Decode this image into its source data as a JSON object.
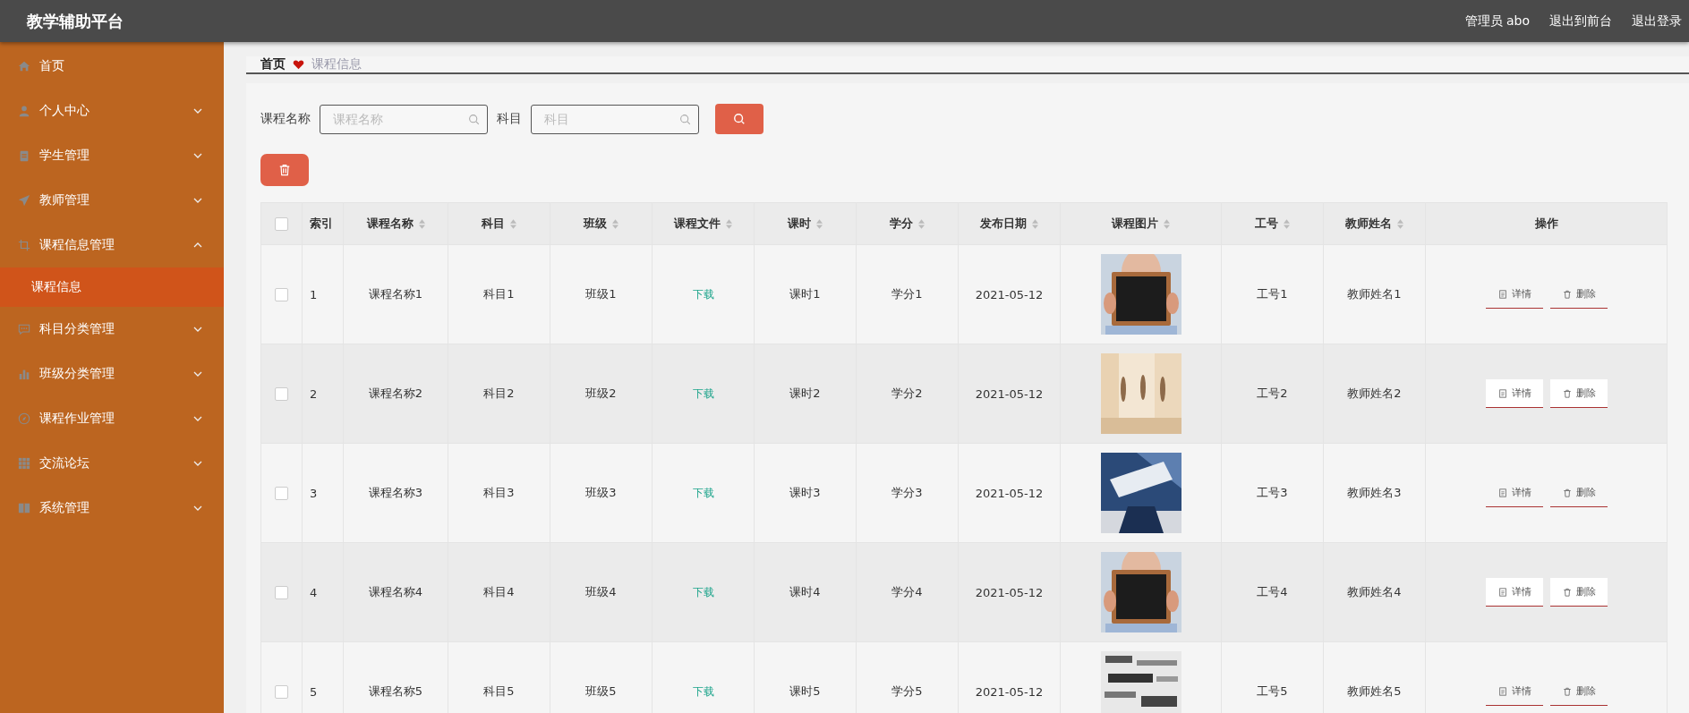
{
  "header": {
    "title": "教学辅助平台",
    "links": [
      "管理员 abo",
      "退出到前台",
      "退出登录"
    ]
  },
  "sidebar": {
    "items": [
      {
        "label": "首页",
        "selected": false
      },
      {
        "label": "个人中心",
        "selected": false,
        "expanded": false
      },
      {
        "label": "学生管理",
        "selected": false,
        "expanded": false
      },
      {
        "label": "教师管理",
        "selected": false,
        "expanded": false
      },
      {
        "label": "课程信息管理",
        "selected": false,
        "expanded": true,
        "children": [
          {
            "label": "课程信息",
            "selected": true
          }
        ]
      },
      {
        "label": "科目分类管理",
        "selected": false,
        "expanded": false
      },
      {
        "label": "班级分类管理",
        "selected": false,
        "expanded": false
      },
      {
        "label": "课程作业管理",
        "selected": false,
        "expanded": false
      },
      {
        "label": "交流论坛",
        "selected": false,
        "expanded": false
      },
      {
        "label": "系统管理",
        "selected": false,
        "expanded": false
      }
    ]
  },
  "breadcrumb": [
    "首页",
    "课程信息"
  ],
  "search": {
    "fields": [
      {
        "label": "课程名称",
        "placeholder": "课程名称"
      },
      {
        "label": "科目",
        "placeholder": "科目"
      }
    ]
  },
  "table": {
    "select_all_checked": false,
    "columns": [
      {
        "label": "索引",
        "sortable": false
      },
      {
        "label": "课程名称",
        "sortable": true
      },
      {
        "label": "科目",
        "sortable": true
      },
      {
        "label": "班级",
        "sortable": true
      },
      {
        "label": "课程文件",
        "sortable": true
      },
      {
        "label": "课时",
        "sortable": true
      },
      {
        "label": "学分",
        "sortable": true
      },
      {
        "label": "发布日期",
        "sortable": true
      },
      {
        "label": "课程图片",
        "sortable": true
      },
      {
        "label": "工号",
        "sortable": true
      },
      {
        "label": "教师姓名",
        "sortable": true
      },
      {
        "label": "操作",
        "sortable": false
      }
    ],
    "rows": [
      {
        "checked": false,
        "index": "1",
        "name": "课程名称1",
        "subject": "科目1",
        "class": "班级1",
        "file": "下载",
        "hours": "课时1",
        "credit": "学分1",
        "date": "2021-05-12",
        "image": {
          "kind": "picture"
        },
        "staff_no": "工号1",
        "teacher": "教师姓名1",
        "actions": [
          "详情",
          "删除"
        ]
      },
      {
        "checked": false,
        "index": "2",
        "name": "课程名称2",
        "subject": "科目2",
        "class": "班级2",
        "file": "下载",
        "hours": "课时2",
        "credit": "学分2",
        "date": "2021-05-12",
        "image": {
          "kind": "picture"
        },
        "staff_no": "工号2",
        "teacher": "教师姓名2",
        "actions": [
          "详情",
          "删除"
        ]
      },
      {
        "checked": false,
        "index": "3",
        "name": "课程名称3",
        "subject": "科目3",
        "class": "班级3",
        "file": "下载",
        "hours": "课时3",
        "credit": "学分3",
        "date": "2021-05-12",
        "image": {
          "kind": "picture"
        },
        "staff_no": "工号3",
        "teacher": "教师姓名3",
        "actions": [
          "详情",
          "删除"
        ]
      },
      {
        "checked": false,
        "index": "4",
        "name": "课程名称4",
        "subject": "科目4",
        "class": "班级4",
        "file": "下载",
        "hours": "课时4",
        "credit": "学分4",
        "date": "2021-05-12",
        "image": {
          "kind": "picture"
        },
        "staff_no": "工号4",
        "teacher": "教师姓名4",
        "actions": [
          "详情",
          "删除"
        ]
      },
      {
        "checked": false,
        "index": "5",
        "name": "课程名称5",
        "subject": "科目5",
        "class": "班级5",
        "file": "下载",
        "hours": "课时5",
        "credit": "学分5",
        "date": "2021-05-12",
        "image": {
          "kind": "picture"
        },
        "staff_no": "工号5",
        "teacher": "教师姓名5",
        "actions": [
          "详情",
          "删除"
        ]
      }
    ]
  }
}
